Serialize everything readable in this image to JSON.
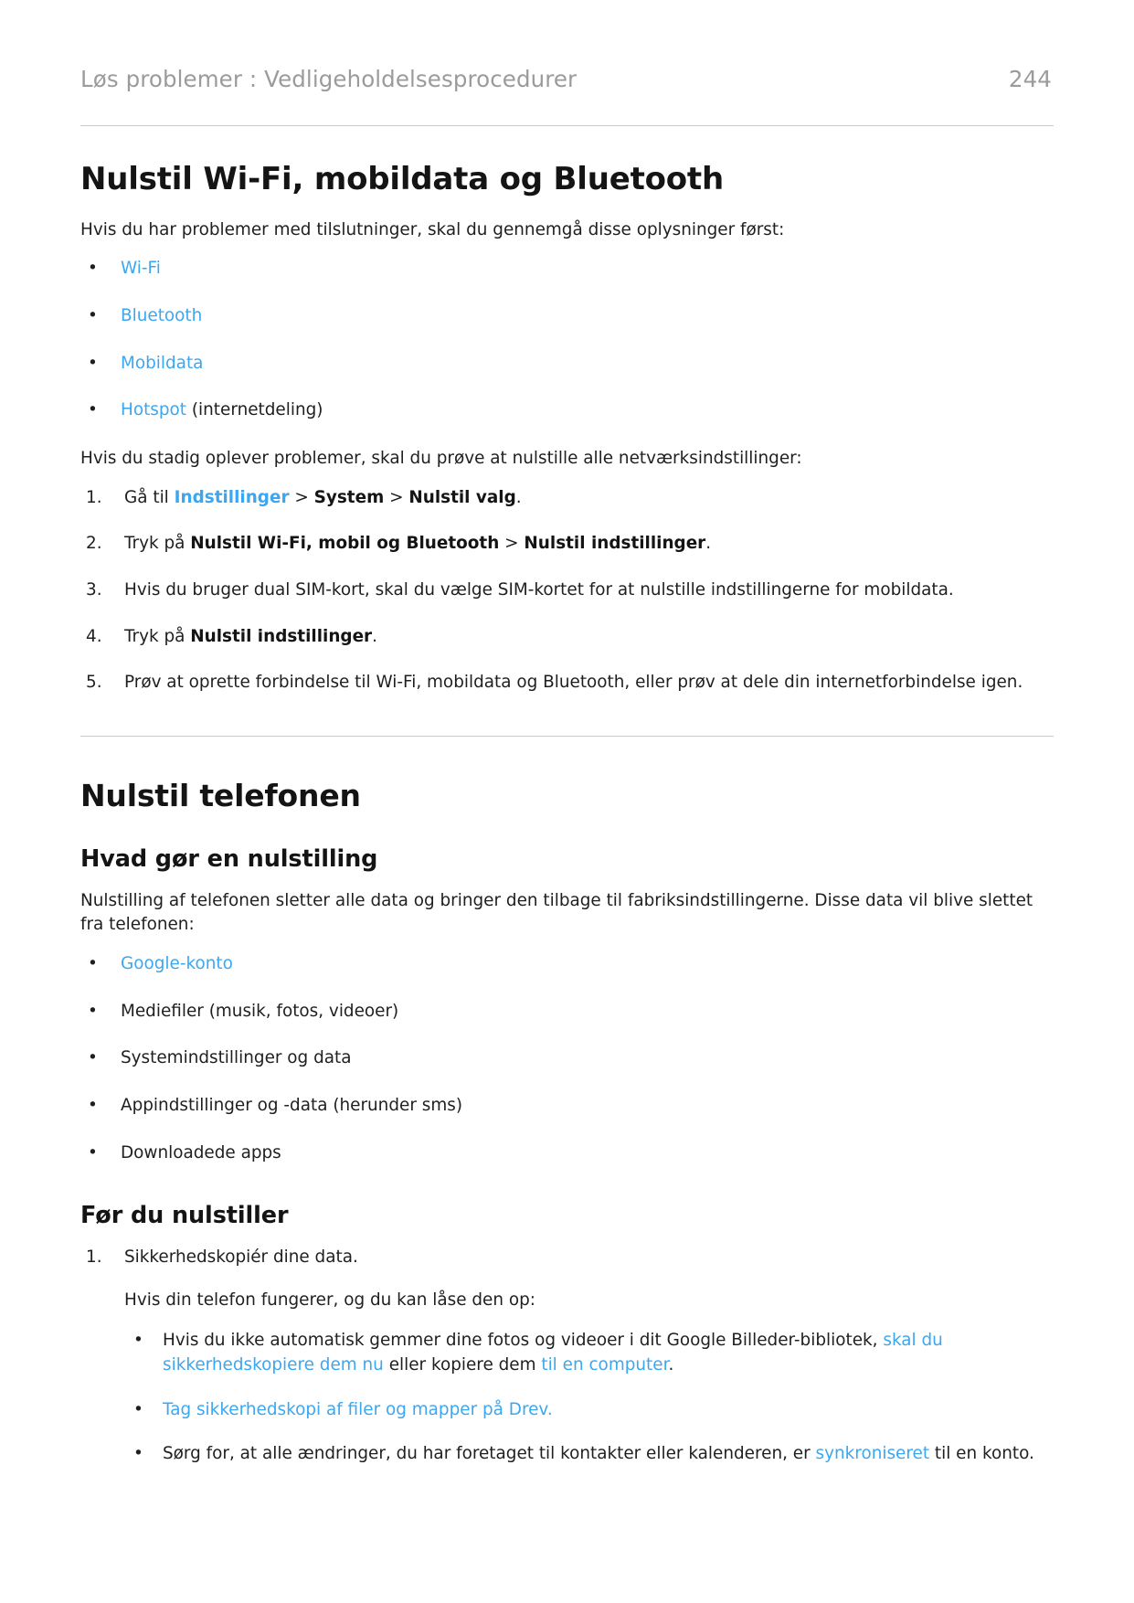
{
  "header": {
    "breadcrumb": "Løs problemer : Vedligeholdelsesprocedurer",
    "page_number": "244"
  },
  "colors": {
    "link": "#3ba7f0",
    "text": "#1f1f1f",
    "header_text": "#9b9b9b",
    "rule": "#c9c9c9"
  },
  "section1": {
    "heading": "Nulstil Wi-Fi, mobildata og Bluetooth",
    "intro": "Hvis du har problemer med tilslutninger, skal du gennemgå disse oplysninger først:",
    "bullets": [
      {
        "link": "Wi-Fi",
        "rest": ""
      },
      {
        "link": "Bluetooth",
        "rest": ""
      },
      {
        "link": "Mobildata",
        "rest": ""
      },
      {
        "link": "Hotspot",
        "rest": " (internetdeling)"
      }
    ],
    "bullet_glyph": "•",
    "subintro": "Hvis du stadig oplever problemer, skal du prøve at nulstille alle netværksindstillinger:",
    "steps": [
      {
        "num": "1.",
        "parts": [
          {
            "type": "text",
            "value": "Gå til "
          },
          {
            "type": "link-bold",
            "value": "Indstillinger"
          },
          {
            "type": "text",
            "value": " > "
          },
          {
            "type": "bold",
            "value": "System"
          },
          {
            "type": "text",
            "value": " > "
          },
          {
            "type": "bold",
            "value": "Nulstil valg"
          },
          {
            "type": "text",
            "value": "."
          }
        ]
      },
      {
        "num": "2.",
        "parts": [
          {
            "type": "text",
            "value": "Tryk på "
          },
          {
            "type": "bold",
            "value": "Nulstil Wi-Fi, mobil og Bluetooth"
          },
          {
            "type": "text",
            "value": " > "
          },
          {
            "type": "bold",
            "value": "Nulstil indstillinger"
          },
          {
            "type": "text",
            "value": "."
          }
        ]
      },
      {
        "num": "3.",
        "parts": [
          {
            "type": "text",
            "value": "Hvis du bruger dual SIM-kort, skal du vælge SIM-kortet for at nulstille indstillingerne for mobildata."
          }
        ]
      },
      {
        "num": "4.",
        "parts": [
          {
            "type": "text",
            "value": "Tryk på "
          },
          {
            "type": "bold",
            "value": "Nulstil indstillinger"
          },
          {
            "type": "text",
            "value": "."
          }
        ]
      },
      {
        "num": "5.",
        "parts": [
          {
            "type": "text",
            "value": "Prøv at oprette forbindelse til Wi-Fi, mobildata og Bluetooth, eller prøv at dele din internetforbindelse igen."
          }
        ]
      }
    ]
  },
  "section2": {
    "heading": "Nulstil telefonen",
    "sub1": {
      "heading": "Hvad gør en nulstilling",
      "intro": "Nulstilling af telefonen sletter alle data og bringer den tilbage til fabriksindstillingerne. Disse data vil blive slettet fra telefonen:",
      "bullets": [
        {
          "link": "Google-konto",
          "rest": ""
        },
        {
          "link": "",
          "rest": "Mediefiler (musik, fotos, videoer)"
        },
        {
          "link": "",
          "rest": "Systemindstillinger og data"
        },
        {
          "link": "",
          "rest": "Appindstillinger og -data (herunder sms)"
        },
        {
          "link": "",
          "rest": "Downloadede apps"
        }
      ]
    },
    "sub2": {
      "heading": "Før du nulstiller",
      "step1": {
        "num": "1.",
        "text": "Sikkerhedskopiér dine data.",
        "sub_para": "Hvis din telefon fungerer, og du kan låse den op:",
        "sub_bullets": [
          {
            "parts": [
              {
                "type": "text",
                "value": "Hvis du ikke automatisk gemmer dine fotos og videoer i dit Google Billeder-bibliotek, "
              },
              {
                "type": "link",
                "value": "skal du sikkerhedskopiere dem nu"
              },
              {
                "type": "text",
                "value": " eller kopiere dem "
              },
              {
                "type": "link",
                "value": "til en computer"
              },
              {
                "type": "text",
                "value": "."
              }
            ]
          },
          {
            "parts": [
              {
                "type": "link",
                "value": "Tag sikkerhedskopi af filer og mapper på Drev."
              }
            ]
          },
          {
            "parts": [
              {
                "type": "text",
                "value": "Sørg for, at alle ændringer, du har foretaget til kontakter eller kalenderen, er "
              },
              {
                "type": "link",
                "value": "synkroniseret"
              },
              {
                "type": "text",
                "value": " til en konto."
              }
            ]
          }
        ]
      }
    }
  }
}
